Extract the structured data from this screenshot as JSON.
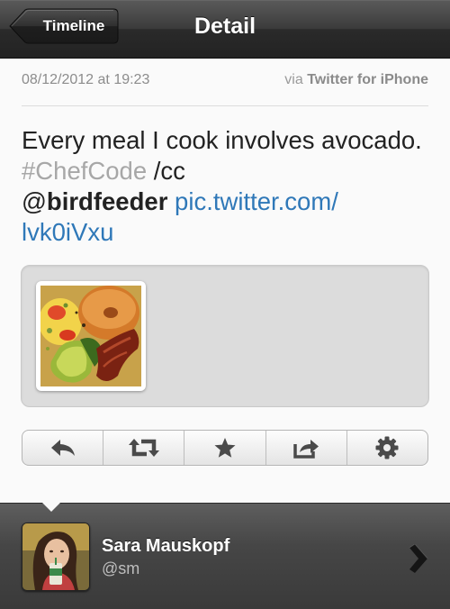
{
  "navbar": {
    "back_label": "Timeline",
    "title": "Detail"
  },
  "tweet": {
    "timestamp": "08/12/2012 at 19:23",
    "via_prefix": "via",
    "client": "Twitter for  iPhone",
    "text": {
      "plain": "Every meal I cook involves avocado.",
      "hashtag": "#ChefCode",
      "cc": "/cc",
      "mention_at": "@",
      "mention_name": "birdfeeder",
      "link_part1": "pic.twitter.com/",
      "link_part2": "lvk0iVxu"
    },
    "media": {
      "description_icon": "photo-thumbnail"
    }
  },
  "actions": [
    {
      "icon": "reply-icon"
    },
    {
      "icon": "retweet-icon"
    },
    {
      "icon": "favorite-star-icon"
    },
    {
      "icon": "share-icon"
    },
    {
      "icon": "settings-gear-icon"
    }
  ],
  "profile": {
    "name": "Sara Mauskopf",
    "handle": "@sm"
  },
  "colors": {
    "link": "#2f78b8",
    "hashtag": "#a7a7a7",
    "nav_dark": "#2a2a2a"
  }
}
